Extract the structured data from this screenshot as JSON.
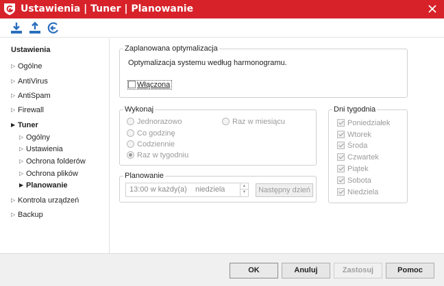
{
  "window": {
    "title": "Ustawienia | Tuner | Planowanie",
    "accent": "#d7222a"
  },
  "toolbar": {
    "buttons": [
      {
        "icon": "download-icon"
      },
      {
        "icon": "upload-icon"
      },
      {
        "icon": "restore-icon"
      }
    ]
  },
  "sidebar": {
    "heading": "Ustawienia",
    "items": [
      {
        "label": "Ogólne"
      },
      {
        "label": "AntiVirus"
      },
      {
        "label": "AntiSpam"
      },
      {
        "label": "Firewall"
      },
      {
        "label": "Tuner"
      },
      {
        "label": "Ogólny"
      },
      {
        "label": "Ustawienia"
      },
      {
        "label": "Ochrona folderów"
      },
      {
        "label": "Ochrona plików"
      },
      {
        "label": "Planowanie"
      },
      {
        "label": "Kontrola urządzeń"
      },
      {
        "label": "Backup"
      }
    ]
  },
  "scheduled": {
    "legend": "Zaplanowana optymalizacja",
    "description": "Optymalizacja systemu według harmonogramu.",
    "enabled_label": "Włączona",
    "enabled": false
  },
  "execute": {
    "legend": "Wykonaj",
    "options": [
      {
        "label": "Jednorazowo",
        "selected": false
      },
      {
        "label": "Co godzinę",
        "selected": false
      },
      {
        "label": "Codziennie",
        "selected": false
      },
      {
        "label": "Raz w tygodniu",
        "selected": true
      },
      {
        "label": "Raz w miesiącu",
        "selected": false
      }
    ]
  },
  "schedule": {
    "legend": "Planowanie",
    "value": "13:00 w każdy(a)    niedziela",
    "next_day_label": "Następny dzień"
  },
  "weekdays": {
    "legend": "Dni tygodnia",
    "days": [
      {
        "label": "Poniedziałek",
        "checked": true
      },
      {
        "label": "Wtorek",
        "checked": true
      },
      {
        "label": "Środa",
        "checked": true
      },
      {
        "label": "Czwartek",
        "checked": true
      },
      {
        "label": "Piątek",
        "checked": true
      },
      {
        "label": "Sobota",
        "checked": true
      },
      {
        "label": "Niedziela",
        "checked": true
      }
    ]
  },
  "footer": {
    "ok_label": "OK",
    "cancel_label": "Anuluj",
    "apply_label": "Zastosuj",
    "help_label": "Pomoc"
  }
}
